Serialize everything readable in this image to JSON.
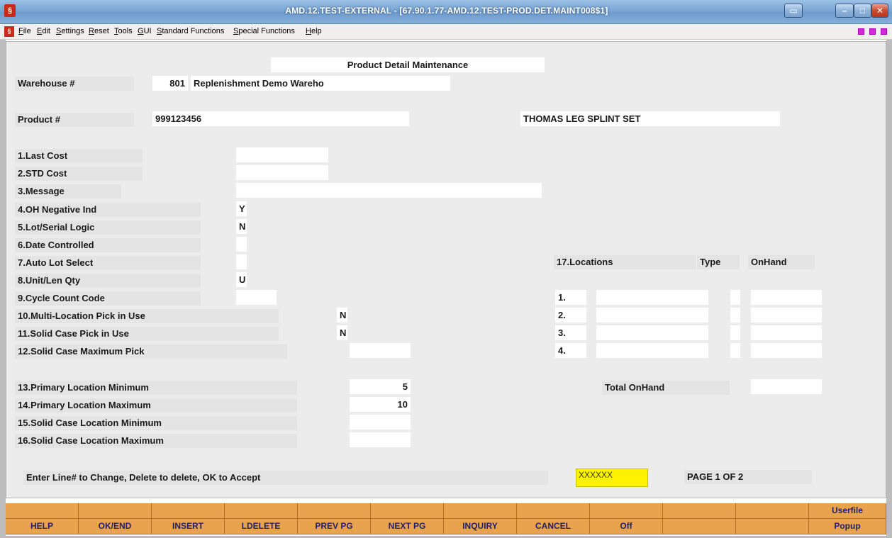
{
  "window": {
    "title": "AMD.12.TEST-EXTERNAL - [67.90.1.77-AMD.12.TEST-PROD.DET.MAINT008$1]",
    "app_icon": "logo-icon"
  },
  "menu": {
    "items": [
      "File",
      "Edit",
      "Settings",
      "Reset",
      "Tools",
      "GUI",
      "Standard Functions",
      "Special Functions",
      "Help"
    ]
  },
  "screen": {
    "title": "Product Detail Maintenance",
    "warehouse_label": "Warehouse #",
    "warehouse_number": "801",
    "warehouse_name": "Replenishment Demo Wareho",
    "product_label": "Product #",
    "product_number": "999123456",
    "product_description": "THOMAS LEG SPLINT SET",
    "fields": [
      {
        "label": "1.Last Cost",
        "value": ""
      },
      {
        "label": "2.STD Cost",
        "value": ""
      },
      {
        "label": "3.Message",
        "value": ""
      },
      {
        "label": "4.OH Negative Ind",
        "value": "Y"
      },
      {
        "label": "5.Lot/Serial Logic",
        "value": "N"
      },
      {
        "label": "6.Date Controlled",
        "value": ""
      },
      {
        "label": "7.Auto Lot Select",
        "value": ""
      },
      {
        "label": "8.Unit/Len Qty",
        "value": "U"
      },
      {
        "label": "9.Cycle Count Code",
        "value": ""
      },
      {
        "label": "10.Multi-Location Pick in Use",
        "value": "N"
      },
      {
        "label": "11.Solid Case Pick in Use",
        "value": "N"
      },
      {
        "label": "12.Solid Case Maximum Pick",
        "value": ""
      },
      {
        "label": "13.Primary Location Minimum",
        "value": "5"
      },
      {
        "label": "14.Primary Location Maximum",
        "value": "10"
      },
      {
        "label": "15.Solid Case Location Minimum",
        "value": ""
      },
      {
        "label": "16.Solid Case Location Maximum",
        "value": ""
      }
    ],
    "locations": {
      "header": "17.Locations",
      "type_header": "Type",
      "onhand_header": "OnHand",
      "rows": [
        {
          "num": "1.",
          "location": "",
          "type": "",
          "onhand": ""
        },
        {
          "num": "2.",
          "location": "",
          "type": "",
          "onhand": ""
        },
        {
          "num": "3.",
          "location": "",
          "type": "",
          "onhand": ""
        },
        {
          "num": "4.",
          "location": "",
          "type": "",
          "onhand": ""
        }
      ],
      "total_label": "Total OnHand",
      "total_value": ""
    },
    "prompt": "Enter Line# to Change, Delete to delete, OK to Accept",
    "input_value": "XXXXXX",
    "page_indicator": "PAGE  1 OF  2"
  },
  "function_keys": {
    "top": [
      "",
      "",
      "",
      "",
      "",
      "",
      "",
      "",
      "",
      "",
      "",
      "Userfile"
    ],
    "bottom": [
      "HELP",
      "OK/END",
      "INSERT",
      "LDELETE",
      "PREV PG",
      "NEXT PG",
      "INQUIRY",
      "CANCEL",
      "Off",
      "",
      "",
      "Popup"
    ]
  },
  "colors": {
    "function_key_bg": "#e9a34e",
    "input_highlight": "#fdf200",
    "work_area_bg": "#ececec"
  }
}
